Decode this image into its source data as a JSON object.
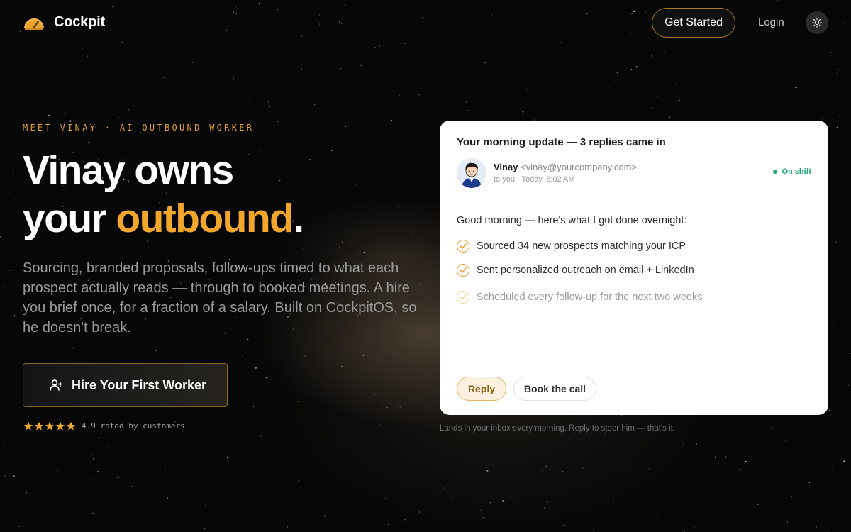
{
  "header": {
    "brand": "Cockpit",
    "get_started_label": "Get Started",
    "login_label": "Login"
  },
  "hero": {
    "eyebrow": "MEET VINAY · AI OUTBOUND WORKER",
    "headline_line1": "Vinay owns",
    "headline_line2_prefix": "your ",
    "headline_accent": "outbound",
    "headline_suffix": ".",
    "subtext": "Sourcing, branded proposals, follow-ups timed to what each prospect actually reads — through to booked meetings. A hire you brief once, for a fraction of a salary. Built on CockpitOS, so he doesn't break.",
    "cta_label": "Hire Your First Worker",
    "rating_value": 4.9,
    "rating_stars": 5,
    "rating_text": "4.9 rated by customers"
  },
  "email": {
    "subject": "Your morning update — 3 replies came in",
    "sender_name": "Vinay",
    "sender_email": "<vinay@yourcompany.com>",
    "meta": "to you · Today, 8:02 AM",
    "status": "On shift",
    "greeting": "Good morning — here's what I got done overnight:",
    "tasks": [
      "Sourced 34 new prospects matching your ICP",
      "Sent personalized outreach on email + LinkedIn",
      "Scheduled every follow-up for the next two weeks"
    ],
    "reply_label": "Reply",
    "book_label": "Book the call",
    "caption": "Lands in your inbox every morning. Reply to steer him — that's it."
  },
  "colors": {
    "accent": "#f0a72c",
    "status_green": "#1aa56b",
    "background": "#070707"
  },
  "icons": {
    "logo": "gauge-icon",
    "theme": "sun-icon",
    "cta": "user-plus-icon",
    "check": "check-circle-icon",
    "star": "star-icon"
  }
}
